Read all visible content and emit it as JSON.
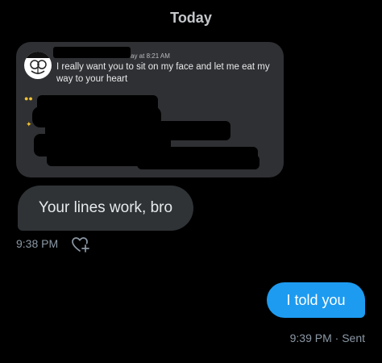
{
  "conversation": {
    "date_header": "Today"
  },
  "shared_post": {
    "meta": "ay at 8:21 AM",
    "text": "I really want you to sit on my face and let me eat my way to your heart",
    "avatar_icon": "cartoon-avatar-icon"
  },
  "messages": [
    {
      "direction": "received",
      "text": "Your lines work, bro",
      "timestamp": "9:38 PM",
      "reaction_icon": "heart-plus-icon"
    },
    {
      "direction": "sent",
      "text": "I told you",
      "status": "9:39 PM · Sent"
    }
  ],
  "colors": {
    "background": "#000000",
    "card": "#2f3033",
    "received_bubble": "#2f3336",
    "sent_bubble": "#1d9bf0",
    "muted_text": "#8b98a5"
  }
}
